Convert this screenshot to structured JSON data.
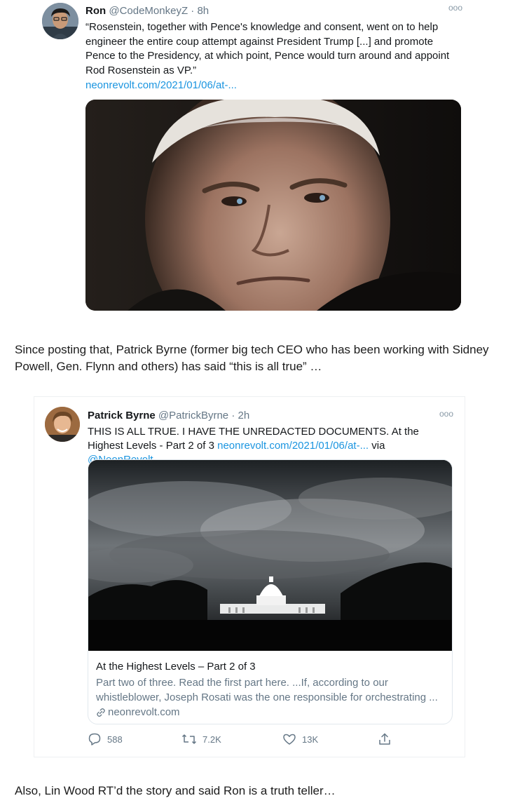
{
  "tweet1": {
    "name": "Ron",
    "handle": "@CodeMonkeyZ",
    "time": "8h",
    "more": "ooo",
    "text": "“Rosenstein, together with Pence's knowledge and consent, went on to help engineer the entire coup attempt against President Trump [...] and promote Pence to the Presidency, at which point, Pence would turn around and appoint Rod Rosenstein as VP.”",
    "link": "neonrevolt.com/2021/01/06/at-..."
  },
  "paragraph1": "Since posting that, Patrick Byrne (former big tech CEO who has been working with Sidney Powell, Gen. Flynn and others) has said “this is all true” …",
  "tweet2": {
    "name": "Patrick Byrne",
    "handle": "@PatrickByrne",
    "time": "2h",
    "more": "ooo",
    "text": "THIS IS ALL TRUE. I HAVE THE UNREDACTED DOCUMENTS. At the Highest Levels - Part 2 of 3",
    "link": "neonrevolt.com/2021/01/06/at-...",
    "via": "via",
    "mention": "@NeonRevolt",
    "card": {
      "title": "At the Highest Levels – Part 2 of 3",
      "description": "Part two of three. Read the first part here. ...If, according to our whistleblower, Joseph Rosati was the one responsible for orchestrating ...",
      "domain": "neonrevolt.com"
    },
    "actions": {
      "replies": "588",
      "retweets": "7.2K",
      "likes": "13K"
    }
  },
  "paragraph2": "Also, Lin Wood RT’d the story and said Ron is a truth teller…",
  "colors": {
    "link": "#1b95e0",
    "secondary_text": "#657786",
    "primary_text": "#14171a"
  }
}
